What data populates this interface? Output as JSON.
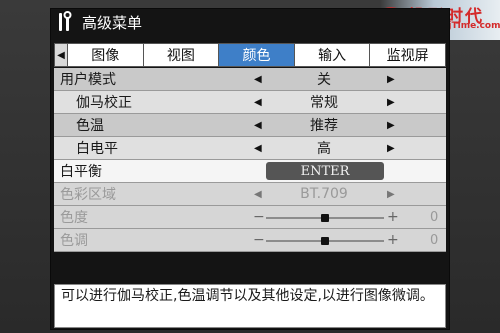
{
  "title": "高级菜单",
  "watermark": {
    "title": "投影时代",
    "url": "www.PjTime.com"
  },
  "tabs": {
    "items": [
      {
        "label": "图像"
      },
      {
        "label": "视图"
      },
      {
        "label": "颜色"
      },
      {
        "label": "输入"
      },
      {
        "label": "监视屏"
      }
    ],
    "active_index": 2
  },
  "rows": [
    {
      "label": "用户模式",
      "value": "关"
    },
    {
      "label": "伽马校正",
      "value": "常规"
    },
    {
      "label": "色温",
      "value": "推荐"
    },
    {
      "label": "白电平",
      "value": "高"
    },
    {
      "label": "白平衡",
      "button": "ENTER"
    },
    {
      "label": "色彩区域",
      "value": "BT.709"
    },
    {
      "label": "色度",
      "slider_value": 0,
      "minus": "−",
      "plus": "+",
      "number": "0"
    },
    {
      "label": "色调",
      "slider_value": 0,
      "minus": "−",
      "plus": "+",
      "number": "0"
    }
  ],
  "help_text": "可以进行伽马校正,色温调节以及其他设定,以进行图像微调。",
  "colors": {
    "active_tab": "#3e7fc8",
    "enter_button": "#555555",
    "watermark": "#d42a2a"
  }
}
